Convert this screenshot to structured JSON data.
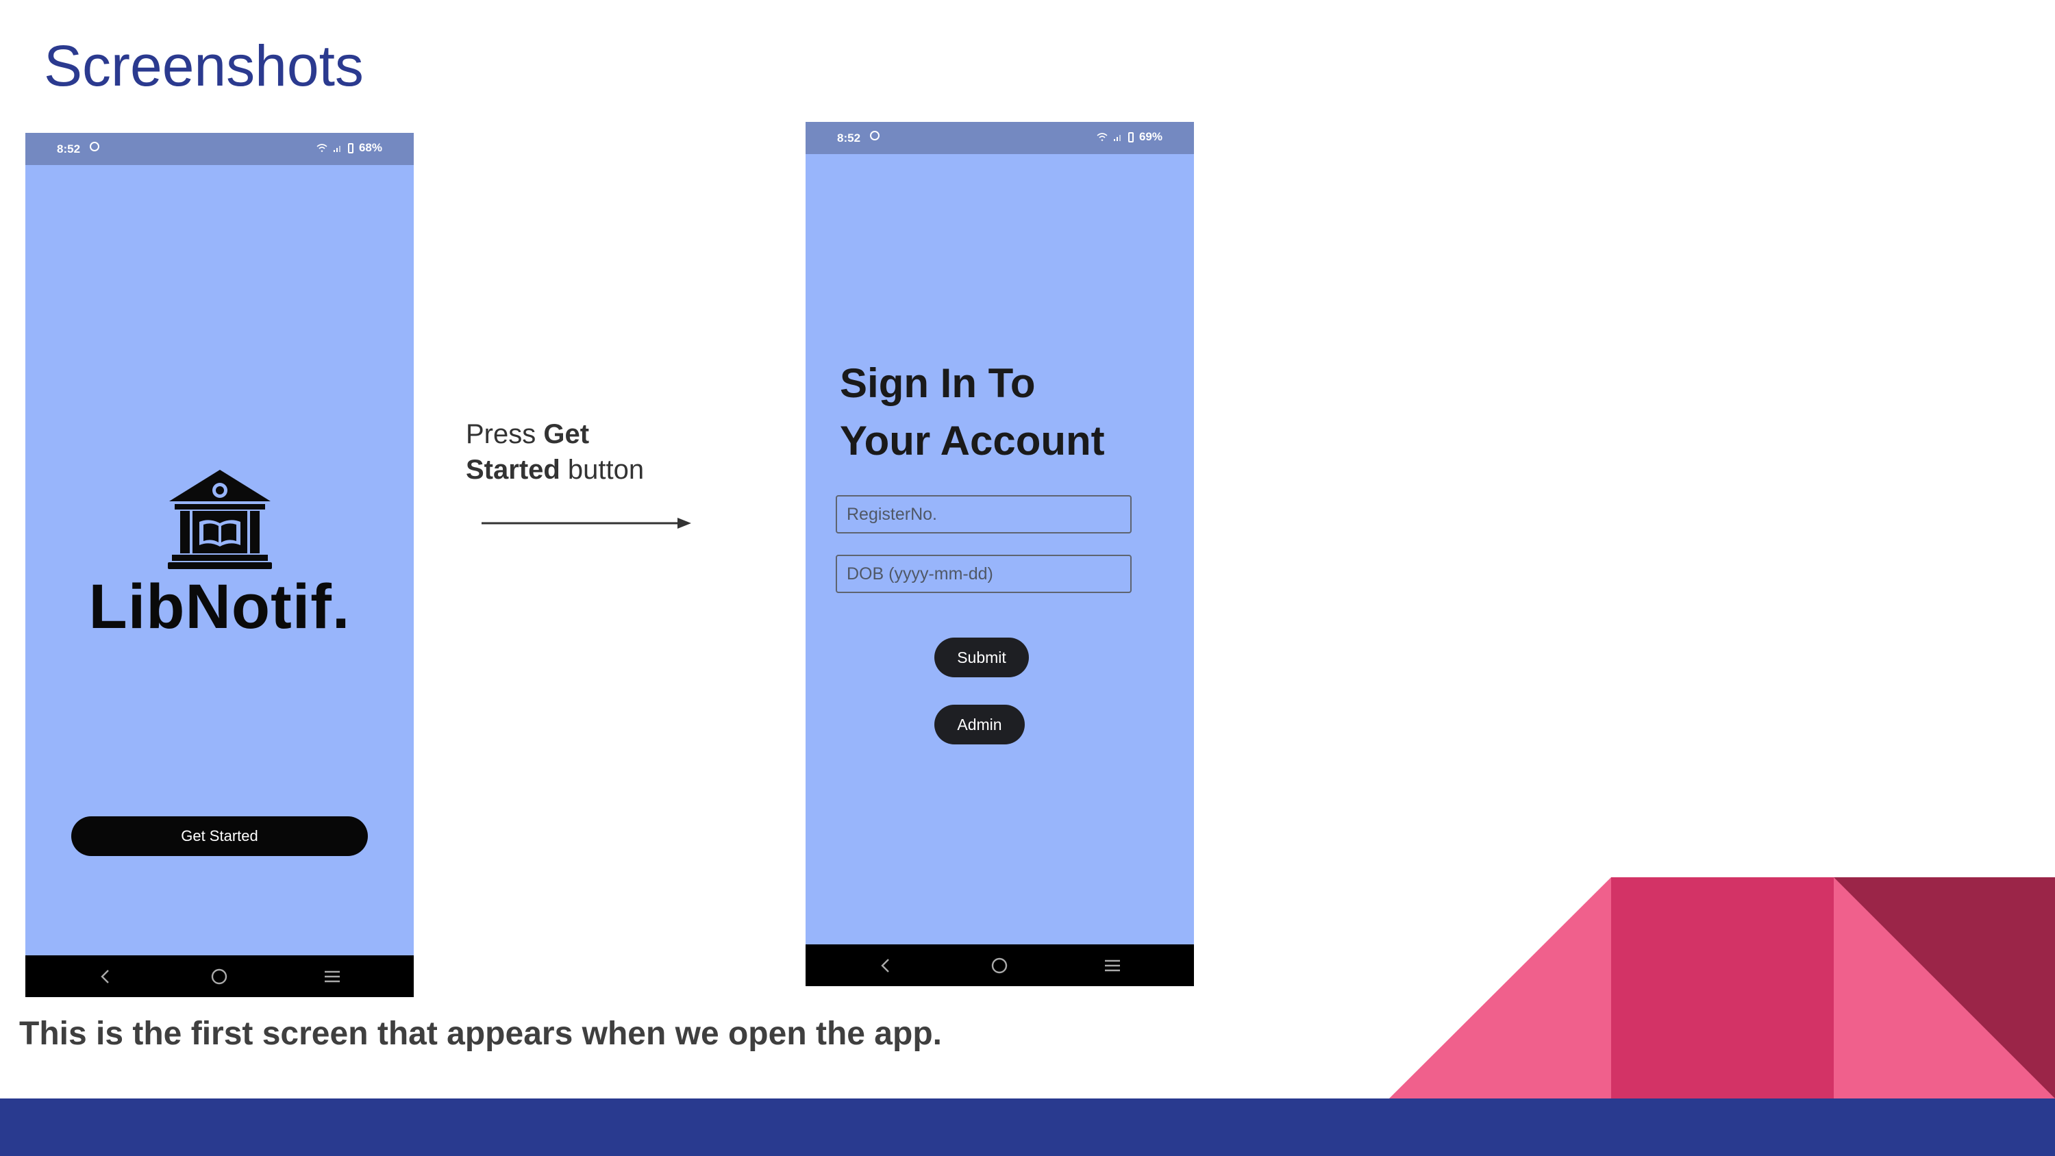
{
  "slide": {
    "title": "Screenshots",
    "caption": "This is the first screen that appears when we open the app.",
    "instruction": {
      "prefix": "Press ",
      "bold1": "Get",
      "bold2": "Started",
      "suffix": " button"
    }
  },
  "phone1": {
    "status_bar": {
      "time": "8:52",
      "battery": "68%"
    },
    "brand": "LibNotif.",
    "get_started_label": "Get Started",
    "nav_icons": [
      "back-icon",
      "home-icon",
      "menu-icon"
    ]
  },
  "phone2": {
    "status_bar": {
      "time": "8:52",
      "battery": "69%"
    },
    "title_line1": "Sign In To",
    "title_line2": "Your Account",
    "register_placeholder": "RegisterNo.",
    "dob_placeholder": "DOB (yyyy-mm-dd)",
    "submit_label": "Submit",
    "admin_label": "Admin",
    "nav_icons": [
      "back-icon",
      "home-icon",
      "menu-icon"
    ]
  },
  "colors": {
    "title": "#2b3a8f",
    "phone_bg": "#98b5fb",
    "status_bar": "#7489c1",
    "footer_band": "#293a8f",
    "pink_light": "#f0608c",
    "pink_mid": "#d33366",
    "pink_dark": "#9b2548"
  }
}
